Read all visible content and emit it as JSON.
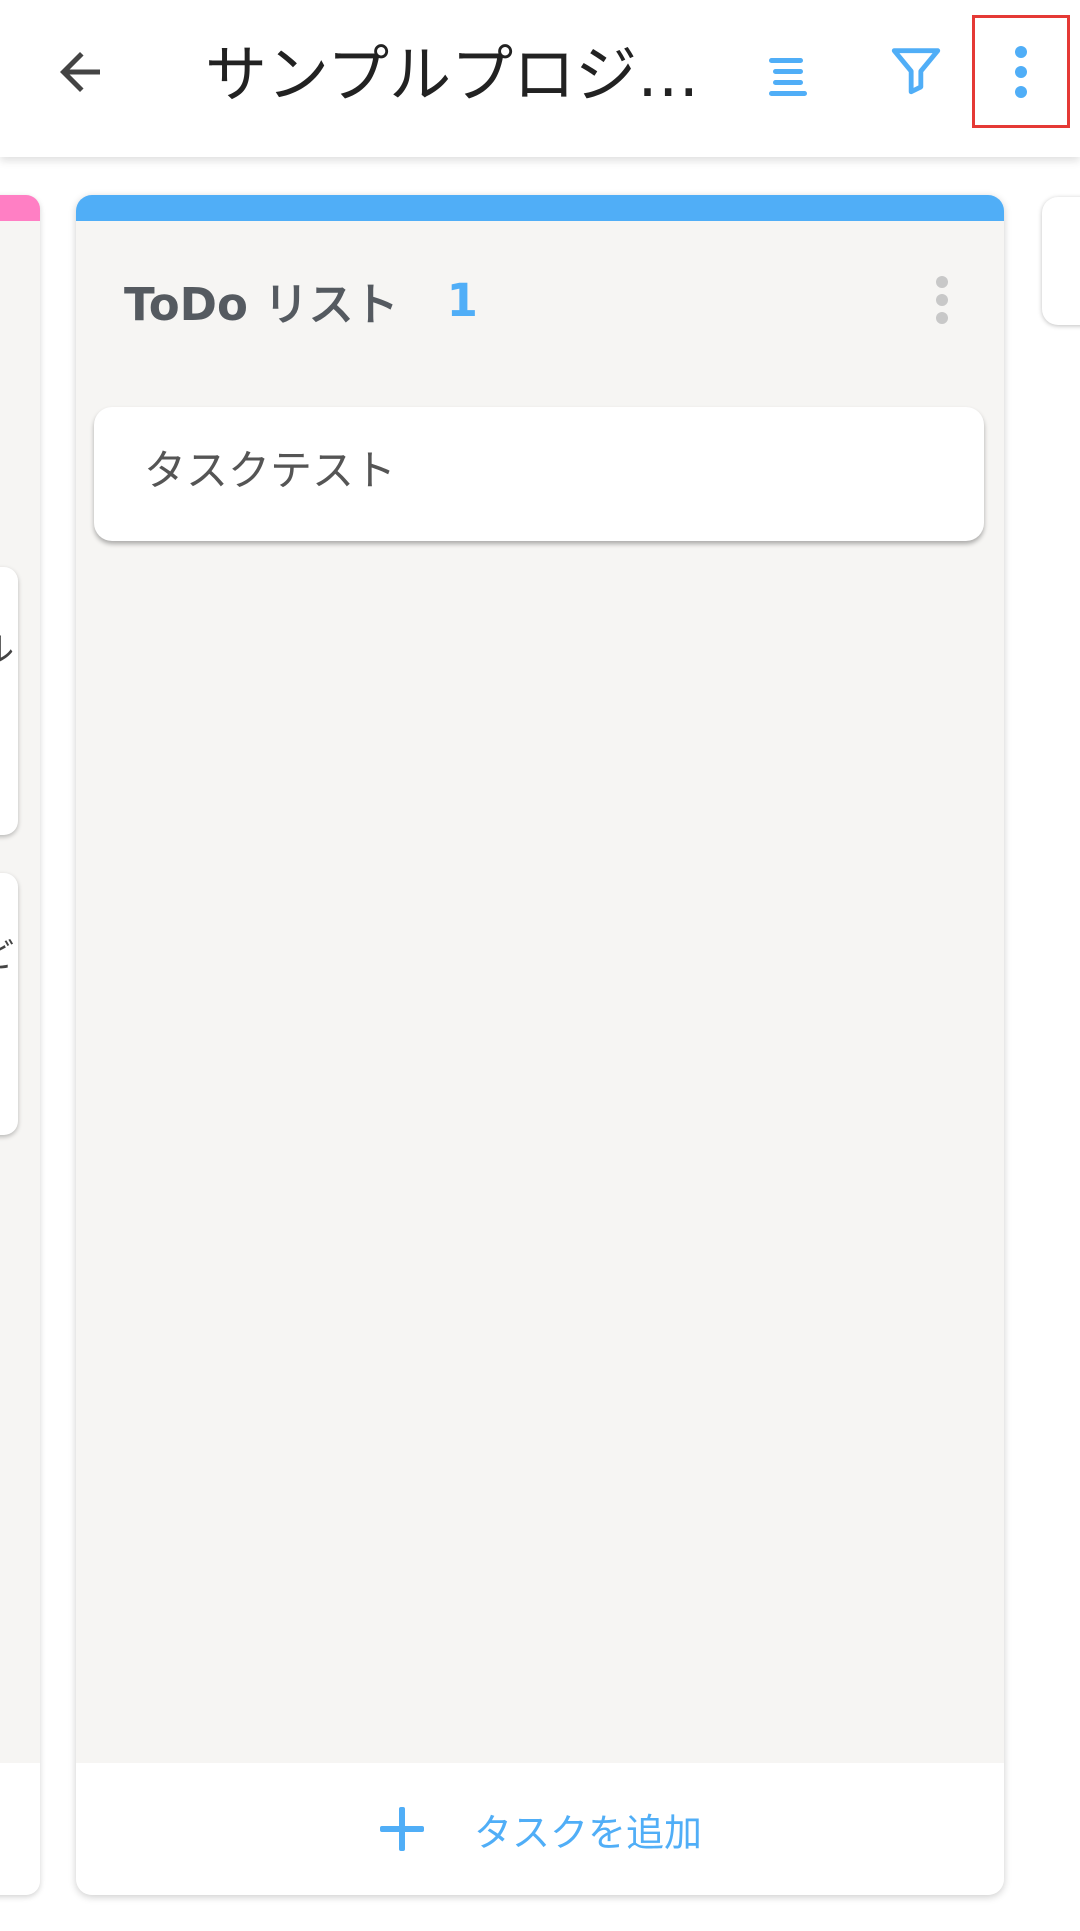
{
  "appbar": {
    "title": "サンプルプロジェ…",
    "back_icon": "arrow-back-icon",
    "sort_icon": "sort-lines-icon",
    "filter_icon": "filter-funnel-icon",
    "more_icon": "more-vert-icon"
  },
  "left_column": {
    "accent_color": "#ff7fc4",
    "cards": [
      {
        "fragment": "ル"
      },
      {
        "fragment": "ど"
      }
    ]
  },
  "main_column": {
    "accent_color": "#50aef7",
    "title": "ToDo リスト",
    "count": "1",
    "tasks": [
      {
        "title": "タスクテスト"
      }
    ],
    "add_label": "タスクを追加"
  },
  "colors": {
    "accent": "#50aef7",
    "highlight_border": "#e53935",
    "column_bg": "#f6f5f3"
  }
}
